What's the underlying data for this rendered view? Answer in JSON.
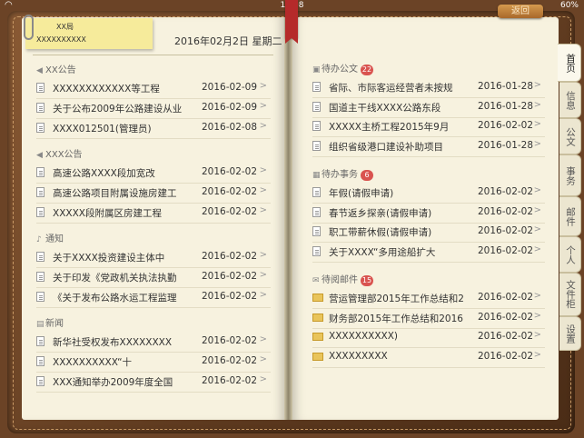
{
  "status": {
    "time": "18:08",
    "battery": "60%"
  },
  "back_label": "返回",
  "sticky": {
    "line1": "XX局",
    "line2": "XXXXXXXXXX"
  },
  "date": "2016年02月2日  星期二",
  "left_sections": [
    {
      "icon": "speaker-icon",
      "title": "XX公告",
      "rows": [
        {
          "title": "XXXXXXXXXXXX等工程",
          "date": "2016-02-09"
        },
        {
          "title": "关于公布2009年公路建设从业",
          "date": "2016-02-09"
        },
        {
          "title": "XXXX012501(管理员)",
          "date": "2016-02-08"
        }
      ]
    },
    {
      "icon": "speaker-icon",
      "title": "XXX公告",
      "rows": [
        {
          "title": "高速公路XXXX段加宽改",
          "date": "2016-02-02"
        },
        {
          "title": "高速公路项目附属设施房建工",
          "date": "2016-02-02"
        },
        {
          "title": "XXXXX段附属区房建工程",
          "date": "2016-02-02"
        }
      ]
    },
    {
      "icon": "bell-icon",
      "title": "通知",
      "rows": [
        {
          "title": "关于XXXX投资建设主体中",
          "date": "2016-02-02"
        },
        {
          "title": "关于印发《党政机关执法执勤",
          "date": "2016-02-02"
        },
        {
          "title": "《关于发布公路水运工程监理",
          "date": "2016-02-02"
        }
      ]
    },
    {
      "icon": "news-icon",
      "title": "新闻",
      "rows": [
        {
          "title": "新华社受权发布XXXXXXXX",
          "date": "2016-02-02"
        },
        {
          "title": "XXXXXXXXXX“十",
          "date": "2016-02-02"
        },
        {
          "title": "XXX通知举办2009年度全国",
          "date": "2016-02-02"
        }
      ]
    }
  ],
  "right_sections": [
    {
      "icon": "briefcase-icon",
      "title": "待办公文",
      "badge": "22",
      "type": "doc",
      "rows": [
        {
          "title": "省际、市际客运经营者未按规",
          "date": "2016-01-28"
        },
        {
          "title": "国道主干线XXXX公路东段",
          "date": "2016-01-28"
        },
        {
          "title": "XXXXX主桥工程2015年9月",
          "date": "2016-02-02"
        },
        {
          "title": "组织省级港口建设补助项目",
          "date": "2016-01-28"
        }
      ]
    },
    {
      "icon": "clipboard-icon",
      "title": "待办事务",
      "badge": "6",
      "type": "doc",
      "rows": [
        {
          "title": "年假(请假申请)",
          "date": "2016-02-02"
        },
        {
          "title": "春节返乡探亲(请假申请)",
          "date": "2016-02-02"
        },
        {
          "title": "职工带薪休假(请假申请)",
          "date": "2016-02-02"
        },
        {
          "title": "关于XXXX“多用途船扩大",
          "date": "2016-02-02"
        }
      ]
    },
    {
      "icon": "envelope-icon",
      "title": "待阅邮件",
      "badge": "15",
      "type": "mail",
      "rows": [
        {
          "title": "营运管理部2015年工作总结和2",
          "date": "2016-02-02"
        },
        {
          "title": "财务部2015年工作总结和2016",
          "date": "2016-02-02"
        },
        {
          "title": "XXXXXXXXXX)",
          "date": "2016-02-02"
        },
        {
          "title": "XXXXXXXXX",
          "date": "2016-02-02"
        }
      ]
    }
  ],
  "tabs": [
    "首页",
    "信息",
    "公文",
    "事务",
    "邮件",
    "个人",
    "文件柜",
    "设置"
  ]
}
